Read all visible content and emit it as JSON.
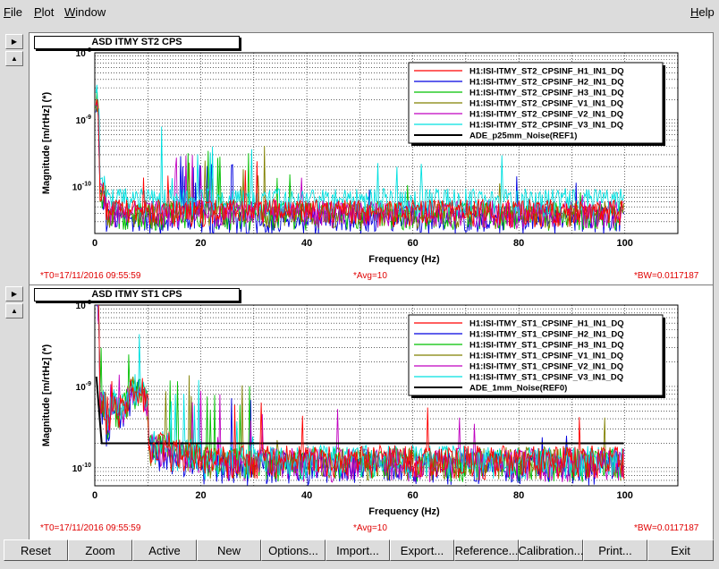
{
  "menu": {
    "file": "File",
    "plot": "Plot",
    "window": "Window",
    "help": "Help"
  },
  "toolbar": [
    "Reset",
    "Zoom",
    "Active",
    "New",
    "Options...",
    "Import...",
    "Export...",
    "Reference...",
    "Calibration...",
    "Print...",
    "Exit"
  ],
  "chart_data": [
    {
      "type": "line",
      "title": "ASD ITMY ST2 CPS",
      "xlabel": "Frequency (Hz)",
      "ylabel": "Magnitude [m/rtHz] (*)",
      "xlim": [
        0,
        110
      ],
      "ylim": [
        2e-11,
        1e-08
      ],
      "yscale": "log",
      "x_ticks": [
        "0",
        "20",
        "40",
        "60",
        "80",
        "100"
      ],
      "y_ticks": [
        "10^-8",
        "10^-9",
        "10^-10"
      ],
      "grid": true,
      "legend_position": "top-right",
      "status": {
        "t0": "*T0=17/11/2016 09:55:59",
        "avg": "*Avg=10",
        "bw": "*BW=0.0117187"
      },
      "series": [
        {
          "name": "H1:ISI-ITMY_ST2_CPSINF_H1_IN1_DQ",
          "color": "#ff0000",
          "base": 4.5e-11
        },
        {
          "name": "H1:ISI-ITMY_ST2_CPSINF_H2_IN1_DQ",
          "color": "#0000e0",
          "base": 3.5e-11
        },
        {
          "name": "H1:ISI-ITMY_ST2_CPSINF_H3_IN1_DQ",
          "color": "#00c000",
          "base": 4e-11
        },
        {
          "name": "H1:ISI-ITMY_ST2_CPSINF_V1_IN1_DQ",
          "color": "#808000",
          "base": 4.2e-11
        },
        {
          "name": "H1:ISI-ITMY_ST2_CPSINF_V2_IN1_DQ",
          "color": "#c000c0",
          "base": 4.3e-11
        },
        {
          "name": "H1:ISI-ITMY_ST2_CPSINF_V3_IN1_DQ",
          "color": "#00e0e0",
          "base": 6.5e-11
        },
        {
          "name": "ADE_p25mm_Noise(REF1)",
          "color": "#000000",
          "base": null
        }
      ]
    },
    {
      "type": "line",
      "title": "ASD ITMY ST1 CPS",
      "xlabel": "Frequency (Hz)",
      "ylabel": "Magnitude [m/rtHz] (*)",
      "xlim": [
        0,
        110
      ],
      "ylim": [
        6e-11,
        1e-08
      ],
      "yscale": "log",
      "x_ticks": [
        "0",
        "20",
        "40",
        "60",
        "80",
        "100"
      ],
      "y_ticks": [
        "10^-8",
        "10^-9",
        "10^-10"
      ],
      "grid": true,
      "legend_position": "top-right",
      "status": {
        "t0": "*T0=17/11/2016 09:55:59",
        "avg": "*Avg=10",
        "bw": "*BW=0.0117187"
      },
      "series": [
        {
          "name": "H1:ISI-ITMY_ST1_CPSINF_H1_IN1_DQ",
          "color": "#ff0000",
          "base": 1.3e-10
        },
        {
          "name": "H1:ISI-ITMY_ST1_CPSINF_H2_IN1_DQ",
          "color": "#0000e0",
          "base": 1.1e-10
        },
        {
          "name": "H1:ISI-ITMY_ST1_CPSINF_H3_IN1_DQ",
          "color": "#00c000",
          "base": 1.2e-10
        },
        {
          "name": "H1:ISI-ITMY_ST1_CPSINF_V1_IN1_DQ",
          "color": "#808000",
          "base": 1.25e-10
        },
        {
          "name": "H1:ISI-ITMY_ST1_CPSINF_V2_IN1_DQ",
          "color": "#c000c0",
          "base": 1.2e-10
        },
        {
          "name": "H1:ISI-ITMY_ST1_CPSINF_V3_IN1_DQ",
          "color": "#00e0e0",
          "base": 1.3e-10
        },
        {
          "name": "ADE_1mm_Noise(REF0)",
          "color": "#000000",
          "base": 2e-10
        }
      ]
    }
  ]
}
